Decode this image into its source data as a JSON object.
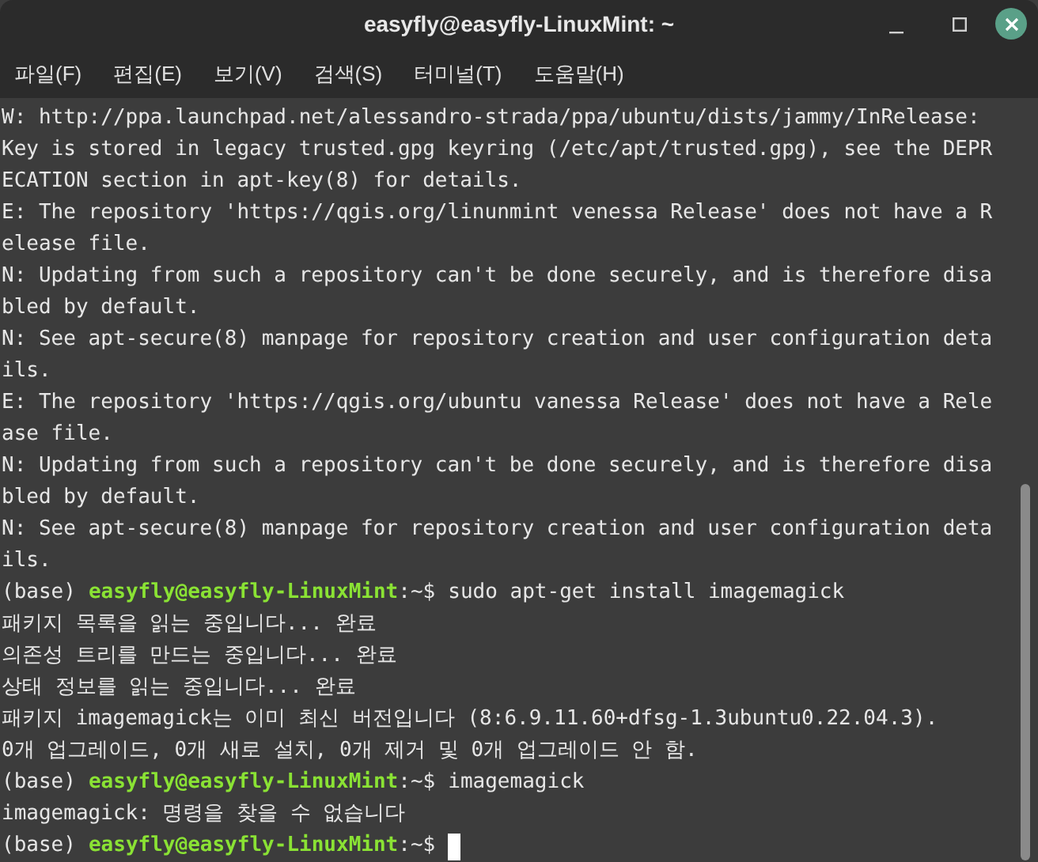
{
  "window": {
    "title": "easyfly@easyfly-LinuxMint: ~"
  },
  "menu": [
    "파일(F)",
    "편집(E)",
    "보기(V)",
    "검색(S)",
    "터미널(T)",
    "도움말(H)"
  ],
  "lines": [
    {
      "kind": "output",
      "text": "W: http://ppa.launchpad.net/alessandro-strada/ppa/ubuntu/dists/jammy/InRelease:"
    },
    {
      "kind": "output",
      "text": "Key is stored in legacy trusted.gpg keyring (/etc/apt/trusted.gpg), see the DEPR"
    },
    {
      "kind": "output",
      "text": "ECATION section in apt-key(8) for details."
    },
    {
      "kind": "output",
      "text": "E: The repository 'https://qgis.org/linunmint venessa Release' does not have a R"
    },
    {
      "kind": "output",
      "text": "elease file."
    },
    {
      "kind": "output",
      "text": "N: Updating from such a repository can't be done securely, and is therefore disa"
    },
    {
      "kind": "output",
      "text": "bled by default."
    },
    {
      "kind": "output",
      "text": "N: See apt-secure(8) manpage for repository creation and user configuration deta"
    },
    {
      "kind": "output",
      "text": "ils."
    },
    {
      "kind": "output",
      "text": "E: The repository 'https://qgis.org/ubuntu vanessa Release' does not have a Rele"
    },
    {
      "kind": "output",
      "text": "ase file."
    },
    {
      "kind": "output",
      "text": "N: Updating from such a repository can't be done securely, and is therefore disa"
    },
    {
      "kind": "output",
      "text": "bled by default."
    },
    {
      "kind": "output",
      "text": "N: See apt-secure(8) manpage for repository creation and user configuration deta"
    },
    {
      "kind": "output",
      "text": "ils."
    },
    {
      "kind": "prompt",
      "env": "(base)",
      "user_host": "easyfly@easyfly-LinuxMint",
      "path": ":~$",
      "command": "sudo apt-get install imagemagick"
    },
    {
      "kind": "output",
      "text": "패키지 목록을 읽는 중입니다... 완료"
    },
    {
      "kind": "output",
      "text": "의존성 트리를 만드는 중입니다... 완료"
    },
    {
      "kind": "output",
      "text": "상태 정보를 읽는 중입니다... 완료"
    },
    {
      "kind": "output",
      "text": "패키지 imagemagick는 이미 최신 버전입니다 (8:6.9.11.60+dfsg-1.3ubuntu0.22.04.3)."
    },
    {
      "kind": "output",
      "text": "0개 업그레이드, 0개 새로 설치, 0개 제거 및 0개 업그레이드 안 함."
    },
    {
      "kind": "prompt",
      "env": "(base)",
      "user_host": "easyfly@easyfly-LinuxMint",
      "path": ":~$",
      "command": "imagemagick"
    },
    {
      "kind": "output",
      "text": "imagemagick: 명령을 찾을 수 없습니다"
    },
    {
      "kind": "prompt",
      "env": "(base)",
      "user_host": "easyfly@easyfly-LinuxMint",
      "path": ":~$",
      "cursor": true
    }
  ]
}
